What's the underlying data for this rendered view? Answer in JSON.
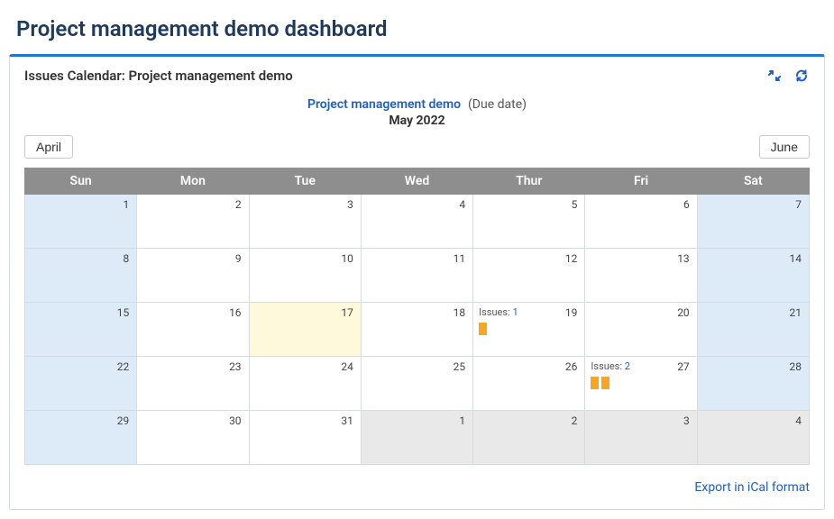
{
  "page_title": "Project management demo dashboard",
  "panel": {
    "title": "Issues Calendar: Project management demo"
  },
  "calendar_header": {
    "project_link": "Project management demo",
    "due_date_label": "(Due date)",
    "month_year": "May 2022"
  },
  "nav": {
    "prev_label": "April",
    "next_label": "June"
  },
  "weekdays": [
    "Sun",
    "Mon",
    "Tue",
    "Wed",
    "Thur",
    "Fri",
    "Sat"
  ],
  "weeks": [
    [
      {
        "day": "1",
        "class": "weekend"
      },
      {
        "day": "2",
        "class": ""
      },
      {
        "day": "3",
        "class": ""
      },
      {
        "day": "4",
        "class": ""
      },
      {
        "day": "5",
        "class": ""
      },
      {
        "day": "6",
        "class": ""
      },
      {
        "day": "7",
        "class": "weekend"
      }
    ],
    [
      {
        "day": "8",
        "class": "weekend"
      },
      {
        "day": "9",
        "class": ""
      },
      {
        "day": "10",
        "class": ""
      },
      {
        "day": "11",
        "class": ""
      },
      {
        "day": "12",
        "class": ""
      },
      {
        "day": "13",
        "class": ""
      },
      {
        "day": "14",
        "class": "weekend"
      }
    ],
    [
      {
        "day": "15",
        "class": "weekend"
      },
      {
        "day": "16",
        "class": ""
      },
      {
        "day": "17",
        "class": "today"
      },
      {
        "day": "18",
        "class": ""
      },
      {
        "day": "19",
        "class": "",
        "issues_prefix": "Issues:",
        "issues_count": "1",
        "blocks": 1
      },
      {
        "day": "20",
        "class": ""
      },
      {
        "day": "21",
        "class": "weekend"
      }
    ],
    [
      {
        "day": "22",
        "class": "weekend"
      },
      {
        "day": "23",
        "class": ""
      },
      {
        "day": "24",
        "class": ""
      },
      {
        "day": "25",
        "class": ""
      },
      {
        "day": "26",
        "class": ""
      },
      {
        "day": "27",
        "class": "",
        "issues_prefix": "Issues:",
        "issues_count": "2",
        "blocks": 2
      },
      {
        "day": "28",
        "class": "weekend"
      }
    ],
    [
      {
        "day": "29",
        "class": "weekend"
      },
      {
        "day": "30",
        "class": ""
      },
      {
        "day": "31",
        "class": ""
      },
      {
        "day": "1",
        "class": "other-month"
      },
      {
        "day": "2",
        "class": "other-month"
      },
      {
        "day": "3",
        "class": "other-month"
      },
      {
        "day": "4",
        "class": "other-month"
      }
    ]
  ],
  "footer": {
    "export_label": "Export in iCal format"
  }
}
